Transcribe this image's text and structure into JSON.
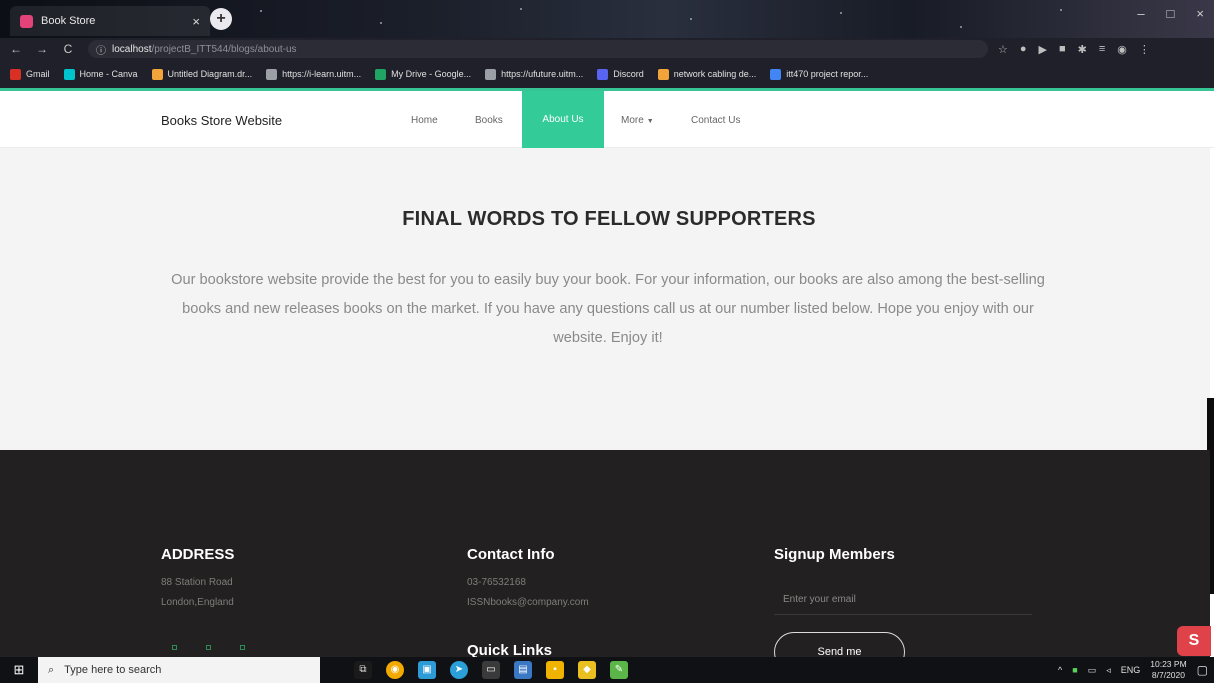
{
  "browser": {
    "tab_title": "Book Store",
    "tab_close": "×",
    "new_tab": "+",
    "window_controls": [
      "–",
      "□",
      "×"
    ],
    "nav": {
      "back": "←",
      "forward": "→",
      "reload": "C",
      "info": "ⓘ"
    },
    "address": {
      "host": "localhost",
      "path": "/projectB_ITT544/blogs/about-us"
    },
    "bookmarks": [
      {
        "label": "Gmail",
        "color": "#d93025"
      },
      {
        "label": "Home - Canva",
        "color": "#00c4cc"
      },
      {
        "label": "Untitled Diagram.dr...",
        "color": "#f2a33a"
      },
      {
        "label": "https://i-learn.uitm...",
        "color": "#9aa0a6"
      },
      {
        "label": "My Drive - Google...",
        "color": "#1fa463"
      },
      {
        "label": "https://ufuture.uitm...",
        "color": "#9aa0a6"
      },
      {
        "label": "Discord",
        "color": "#5865f2"
      },
      {
        "label": "network cabling de...",
        "color": "#f2a33a"
      },
      {
        "label": "itt470 project repor...",
        "color": "#4285f4"
      }
    ]
  },
  "site": {
    "brand": "Books Store Website",
    "nav": {
      "home": "Home",
      "books": "Books",
      "about": "About Us",
      "more": "More",
      "more_caret": "▼",
      "contact": "Contact Us"
    },
    "accent_color": "#33cc99"
  },
  "about": {
    "title": "FINAL WORDS TO FELLOW SUPPORTERS",
    "paragraph": "Our bookstore website provide the best for you to easily buy your book. For your information, our books are also among the best-selling books and new releases books on the market. If you have any questions call us at our number listed below. Hope you enjoy with our website. Enjoy it!"
  },
  "footer": {
    "address": {
      "heading": "ADDRESS",
      "line1": "88 Station Road",
      "line2": "London,England"
    },
    "contact": {
      "heading": "Contact Info",
      "phone": "03-76532168",
      "email": "ISSNbooks@company.com",
      "quick_links": "Quick Links"
    },
    "signup": {
      "heading": "Signup Members",
      "email_placeholder": "Enter your email",
      "button": "Send me"
    }
  },
  "taskbar": {
    "search_placeholder": "Type here to search",
    "tray_language": "ENG",
    "time": "10:23 PM",
    "date": "8/7/2020"
  }
}
